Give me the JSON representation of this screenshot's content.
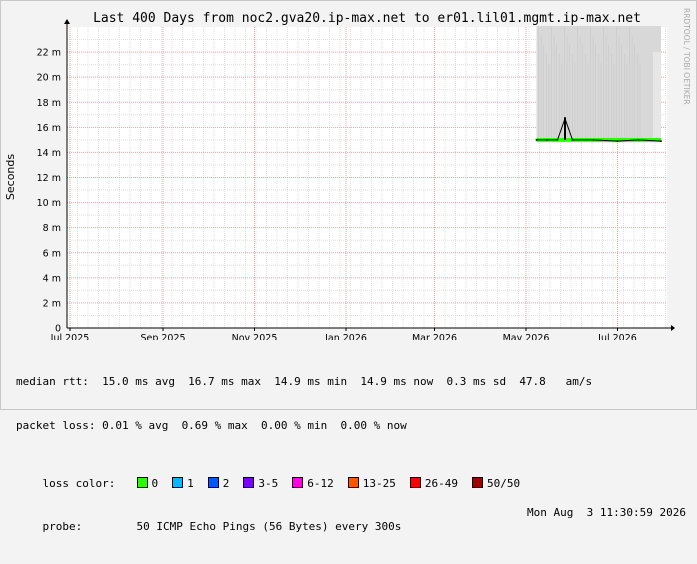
{
  "chart_data": {
    "type": "area",
    "title": "Last 400 Days from noc2.gva20.ip-max.net to er01.lil01.mgmt.ip-max.net",
    "ylabel": "Seconds",
    "xlabel": "",
    "ylim": [
      0,
      24
    ],
    "yticks": [
      "0",
      "2 m",
      "4 m",
      "6 m",
      "8 m",
      "10 m",
      "12 m",
      "14 m",
      "16 m",
      "18 m",
      "20 m",
      "22 m"
    ],
    "ytick_values": [
      0,
      2,
      4,
      6,
      8,
      10,
      12,
      14,
      16,
      18,
      20,
      22
    ],
    "y_unit_note": "milliseconds",
    "xticks": [
      "Jul 2025",
      "Sep 2025",
      "Nov 2025",
      "Jan 2026",
      "Mar 2026",
      "May 2026",
      "Jul 2026"
    ],
    "xlim": [
      "2025-06-29",
      "2026-08-03"
    ],
    "xtick_dates": [
      "2025-07-01",
      "2025-09-01",
      "2025-11-01",
      "2026-01-01",
      "2026-03-01",
      "2026-05-01",
      "2026-07-01"
    ],
    "grid": true,
    "series": [
      {
        "name": "median rtt",
        "color": "#000000",
        "x": [
          "2026-05-08",
          "2026-05-15",
          "2026-05-22",
          "2026-05-27",
          "2026-06-01",
          "2026-06-15",
          "2026-07-01",
          "2026-07-15",
          "2026-07-30"
        ],
        "values": [
          15.0,
          15.0,
          15.0,
          16.7,
          15.0,
          15.0,
          14.9,
          15.0,
          14.9
        ]
      },
      {
        "name": "jitter smoke",
        "color": "#d8d8d8",
        "x": [
          "2026-05-08",
          "2026-06-01",
          "2026-07-01",
          "2026-07-30"
        ],
        "min": [
          14.8,
          14.8,
          14.8,
          14.8
        ],
        "max": [
          24.0,
          24.0,
          24.0,
          22.0
        ]
      },
      {
        "name": "0 loss band",
        "color": "#26ff00",
        "x": [
          "2026-05-08",
          "2026-07-30"
        ],
        "values": [
          15.0,
          15.0
        ]
      }
    ]
  },
  "watermark": "RRDTOOL / TOBI OETIKER",
  "stats": {
    "median_rtt": "median rtt:  15.0 ms avg  16.7 ms max  14.9 ms min  14.9 ms now  0.3 ms sd  47.8   am/s",
    "packet_loss": "packet loss: 0.01 % avg  0.69 % max  0.00 % min  0.00 % now"
  },
  "loss_color": {
    "label": "loss color:",
    "items": [
      {
        "label": "0",
        "color": "#26ff00"
      },
      {
        "label": "1",
        "color": "#00b8ff"
      },
      {
        "label": "2",
        "color": "#0059ff"
      },
      {
        "label": "3-5",
        "color": "#7e00ff"
      },
      {
        "label": "6-12",
        "color": "#ff00e6"
      },
      {
        "label": "13-25",
        "color": "#ff5500"
      },
      {
        "label": "26-49",
        "color": "#ff0000"
      },
      {
        "label": "50/50",
        "color": "#a10000"
      }
    ]
  },
  "probe": {
    "label": "probe:",
    "text": "50 ICMP Echo Pings (56 Bytes) every 300s",
    "date": "Mon Aug  3 11:30:59 2026"
  }
}
